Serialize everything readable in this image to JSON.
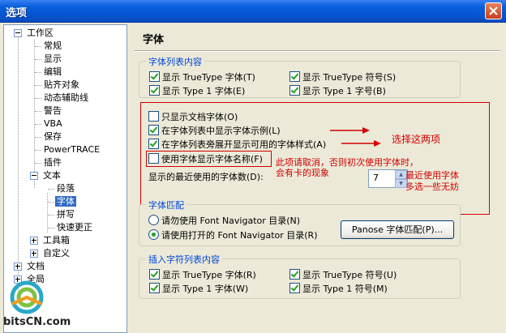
{
  "window": {
    "title": "选项"
  },
  "tree": {
    "items": [
      "工作区",
      "常规",
      "显示",
      "编辑",
      "贴齐对象",
      "动态辅助线",
      "警告",
      "VBA",
      "保存",
      "PowerTRACE",
      "插件",
      "文本",
      "段落",
      "字体",
      "拼写",
      "快速更正",
      "工具箱",
      "自定义",
      "文档",
      "全局"
    ]
  },
  "logo": {
    "text": "bitsCN.com"
  },
  "panel": {
    "title": "字体",
    "font_list": {
      "title": "字体列表内容",
      "truetype_fonts": "显示 TrueType 字体(T)",
      "truetype_symbols": "显示 TrueType 符号(S)",
      "type1_fonts": "显示 Type 1 字体(E)",
      "type1_symbols": "显示 Type 1 字号(B)"
    },
    "options": {
      "only_doc_fonts": "只显示文档字体(O)",
      "show_font_sample": "在字体列表中显示字体示例(L)",
      "show_available_styles": "在字体列表旁展开显示可用的字体样式(A)",
      "use_font_name": "使用字体显示字体名称(F)",
      "recent_count_label": "显示的最近使用的字体数(D):",
      "recent_count_value": "7"
    },
    "annotations": {
      "choose_two": "选择这两项",
      "cancel_note_1": "此项请取消，否则初次使用字体时，",
      "cancel_note_2": "会有卡的现象",
      "recent_note_1": "最近使用字体",
      "recent_note_2": "多选一些无妨",
      "color": "#d40000"
    },
    "font_match": {
      "title": "字体匹配",
      "radio_ask": "请勿使用 Font Navigator 目录(N)",
      "radio_use": "请使用打开的 Font Navigator 目录(R)",
      "panose_button": "Panose 字体匹配(P)..."
    },
    "insert_list": {
      "title": "插入字符列表内容",
      "truetype_fonts": "显示 TrueType 字体(R)",
      "truetype_symbols": "显示 TrueType 符号(U)",
      "type1_fonts": "显示 Type 1 字体(W)",
      "type1_symbols": "显示 Type 1 符号(M)"
    }
  }
}
